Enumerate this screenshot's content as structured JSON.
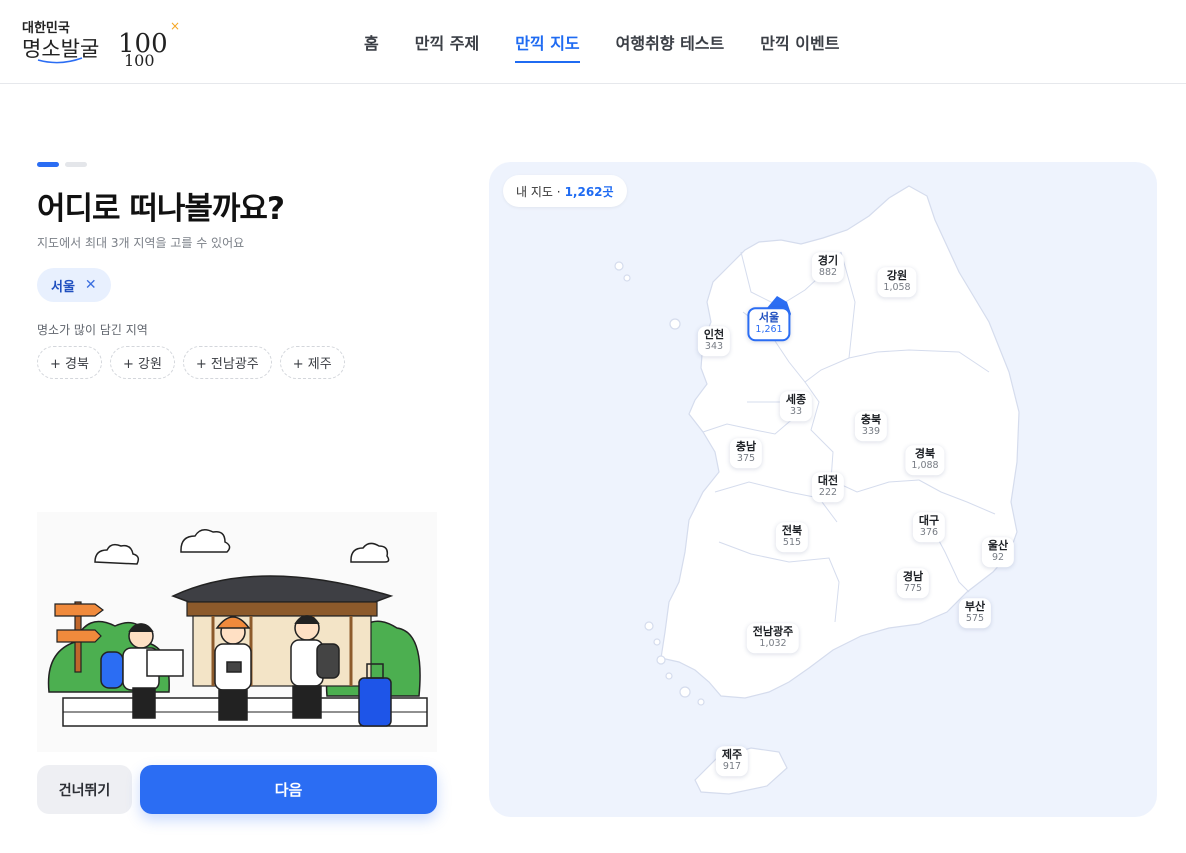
{
  "header": {
    "logo_text": "대한민국 명소발굴 100×100",
    "nav": [
      {
        "label": "홈",
        "active": false
      },
      {
        "label": "만끽 주제",
        "active": false
      },
      {
        "label": "만끽 지도",
        "active": true
      },
      {
        "label": "여행취향 테스트",
        "active": false
      },
      {
        "label": "만끽 이벤트",
        "active": false
      }
    ]
  },
  "main": {
    "title": "어디로 떠나볼까요?",
    "subtitle": "지도에서 최대 3개 지역을 고를 수 있어요",
    "selected": [
      {
        "label": "서울"
      }
    ],
    "suggest_label": "명소가 많이 담긴 지역",
    "suggestions": [
      "+ 경북",
      "+ 강원",
      "+ 전남광주",
      "+ 제주"
    ],
    "skip_label": "건너뛰기",
    "next_label": "다음"
  },
  "map": {
    "badge_prefix": "내 지도 ·",
    "badge_count": "1,262곳",
    "regions": [
      {
        "name": "경기",
        "count": "882"
      },
      {
        "name": "강원",
        "count": "1,058"
      },
      {
        "name": "서울",
        "count": "1,261",
        "selected": true
      },
      {
        "name": "인천",
        "count": "343"
      },
      {
        "name": "세종",
        "count": "33"
      },
      {
        "name": "충북",
        "count": "339"
      },
      {
        "name": "충남",
        "count": "375"
      },
      {
        "name": "경북",
        "count": "1,088"
      },
      {
        "name": "대전",
        "count": "222"
      },
      {
        "name": "대구",
        "count": "376"
      },
      {
        "name": "전북",
        "count": "515"
      },
      {
        "name": "울산",
        "count": "92"
      },
      {
        "name": "경남",
        "count": "775"
      },
      {
        "name": "부산",
        "count": "575"
      },
      {
        "name": "전남광주",
        "count": "1,032"
      },
      {
        "name": "제주",
        "count": "917"
      }
    ]
  },
  "colors": {
    "accent": "#2b6df3",
    "map_bg": "#eef3fd"
  }
}
